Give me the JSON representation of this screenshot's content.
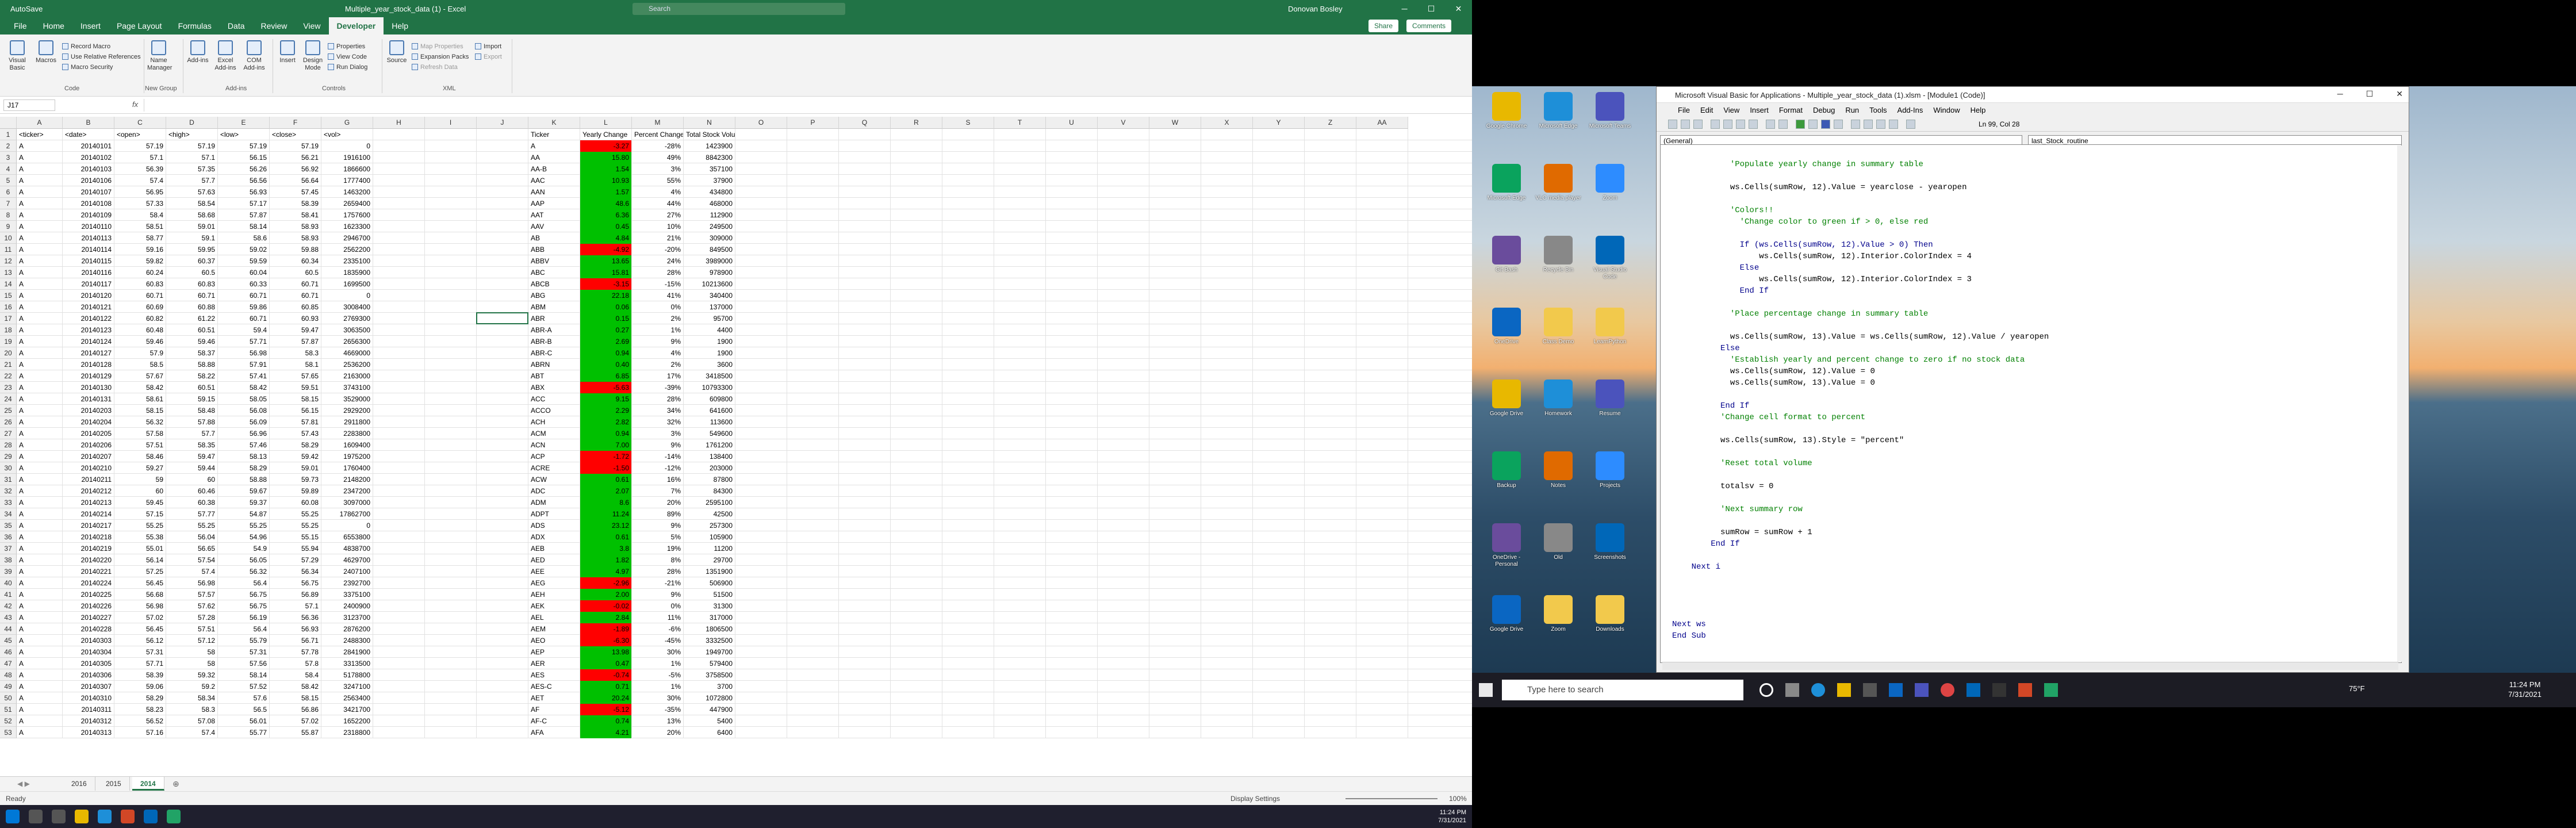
{
  "excel": {
    "title": "Multiple_year_stock_data (1) - Excel",
    "autosave": "AutoSave",
    "search_placeholder": "Search",
    "user": "Donovan Bosley",
    "menu_tabs": [
      "File",
      "Home",
      "Insert",
      "Page Layout",
      "Formulas",
      "Data",
      "Review",
      "View",
      "Developer",
      "Help"
    ],
    "active_tab": "Developer",
    "share_label": "Share",
    "comments_label": "Comments",
    "ribbon": {
      "visual_basic": "Visual Basic",
      "macros": "Macros",
      "record_macro": "Record Macro",
      "relative": "Use Relative References",
      "macro_security": "Macro Security",
      "group_code": "Code",
      "addins": "Add-ins",
      "excel_addins": "Excel Add-ins",
      "com_addins": "COM Add-ins",
      "group_addins": "Add-ins",
      "name_manager": "Name Manager",
      "group_newgroup": "New Group",
      "insert": "Insert",
      "design_mode": "Design Mode",
      "properties": "Properties",
      "view_code": "View Code",
      "run_dialog": "Run Dialog",
      "group_controls": "Controls",
      "source": "Source",
      "map_properties": "Map Properties",
      "expansion_packs": "Expansion Packs",
      "refresh_data": "Refresh Data",
      "import": "Import",
      "export": "Export",
      "group_xml": "XML"
    },
    "name_box": "J17",
    "fx": "fx",
    "col_letters": [
      "A",
      "B",
      "C",
      "D",
      "E",
      "F",
      "G",
      "H",
      "I",
      "J",
      "K",
      "L",
      "M",
      "N",
      "O",
      "P",
      "Q",
      "R",
      "S",
      "T",
      "U",
      "V",
      "W",
      "X",
      "Y",
      "Z",
      "AA"
    ],
    "headers": {
      "ticker": "<ticker>",
      "date": "<date>",
      "open": "<open>",
      "high": "<high>",
      "low": "<low>",
      "close": "<close>",
      "vol": "<vol>"
    },
    "summary_headers": {
      "ticker": "Ticker",
      "yearly": "Yearly Change",
      "percent": "Percent Change",
      "total": "Total Stock Volume"
    },
    "rows": [
      [
        "A",
        "20140101",
        "57.19",
        "57.19",
        "57.19",
        "57.19",
        "0",
        "A",
        "-3.27",
        "-28%",
        "1423900",
        "r"
      ],
      [
        "A",
        "20140102",
        "57.1",
        "57.1",
        "56.15",
        "56.21",
        "1916100",
        "AA",
        "15.80",
        "49%",
        "8842300",
        "g"
      ],
      [
        "A",
        "20140103",
        "56.39",
        "57.35",
        "56.26",
        "56.92",
        "1866600",
        "AA-B",
        "1.54",
        "3%",
        "357100",
        "g"
      ],
      [
        "A",
        "20140106",
        "57.4",
        "57.7",
        "56.56",
        "56.64",
        "1777400",
        "AAC",
        "10.93",
        "55%",
        "37900",
        "g"
      ],
      [
        "A",
        "20140107",
        "56.95",
        "57.63",
        "56.93",
        "57.45",
        "1463200",
        "AAN",
        "1.57",
        "4%",
        "434800",
        "g"
      ],
      [
        "A",
        "20140108",
        "57.33",
        "58.54",
        "57.17",
        "58.39",
        "2659400",
        "AAP",
        "48.6",
        "44%",
        "468000",
        "g"
      ],
      [
        "A",
        "20140109",
        "58.4",
        "58.68",
        "57.87",
        "58.41",
        "1757600",
        "AAT",
        "6.36",
        "27%",
        "112900",
        "g"
      ],
      [
        "A",
        "20140110",
        "58.51",
        "59.01",
        "58.14",
        "58.93",
        "1623300",
        "AAV",
        "0.45",
        "10%",
        "249500",
        "g"
      ],
      [
        "A",
        "20140113",
        "58.77",
        "59.1",
        "58.6",
        "58.93",
        "2946700",
        "AB",
        "4.84",
        "21%",
        "309000",
        "g"
      ],
      [
        "A",
        "20140114",
        "59.16",
        "59.95",
        "59.02",
        "59.88",
        "2562200",
        "ABB",
        "-4.92",
        "-20%",
        "849500",
        "r"
      ],
      [
        "A",
        "20140115",
        "59.82",
        "60.37",
        "59.59",
        "60.34",
        "2335100",
        "ABBV",
        "13.65",
        "24%",
        "3989000",
        "g"
      ],
      [
        "A",
        "20140116",
        "60.24",
        "60.5",
        "60.04",
        "60.5",
        "1835900",
        "ABC",
        "15.81",
        "28%",
        "978900",
        "g"
      ],
      [
        "A",
        "20140117",
        "60.83",
        "60.83",
        "60.33",
        "60.71",
        "1699500",
        "ABCB",
        "-3.15",
        "-15%",
        "10213600",
        "r"
      ],
      [
        "A",
        "20140120",
        "60.71",
        "60.71",
        "60.71",
        "60.71",
        "0",
        "ABG",
        "22.18",
        "41%",
        "340400",
        "g"
      ],
      [
        "A",
        "20140121",
        "60.69",
        "60.88",
        "59.86",
        "60.85",
        "3008400",
        "ABM",
        "0.06",
        "0%",
        "137000",
        "g"
      ],
      [
        "A",
        "20140122",
        "60.82",
        "61.22",
        "60.71",
        "60.93",
        "2769300",
        "ABR",
        "0.15",
        "2%",
        "95700",
        "g"
      ],
      [
        "A",
        "20140123",
        "60.48",
        "60.51",
        "59.4",
        "59.47",
        "3063500",
        "ABR-A",
        "0.27",
        "1%",
        "4400",
        "g"
      ],
      [
        "A",
        "20140124",
        "59.46",
        "59.46",
        "57.71",
        "57.87",
        "2656300",
        "ABR-B",
        "2.69",
        "9%",
        "1900",
        "g"
      ],
      [
        "A",
        "20140127",
        "57.9",
        "58.37",
        "56.98",
        "58.3",
        "4669000",
        "ABR-C",
        "0.94",
        "4%",
        "1900",
        "g"
      ],
      [
        "A",
        "20140128",
        "58.5",
        "58.88",
        "57.91",
        "58.1",
        "2536200",
        "ABRN",
        "0.40",
        "2%",
        "3600",
        "g"
      ],
      [
        "A",
        "20140129",
        "57.67",
        "58.22",
        "57.41",
        "57.65",
        "2163000",
        "ABT",
        "6.85",
        "17%",
        "3418500",
        "g"
      ],
      [
        "A",
        "20140130",
        "58.42",
        "60.51",
        "58.42",
        "59.51",
        "3743100",
        "ABX",
        "-5.63",
        "-39%",
        "10793300",
        "r"
      ],
      [
        "A",
        "20140131",
        "58.61",
        "59.15",
        "58.05",
        "58.15",
        "3529000",
        "ACC",
        "9.15",
        "28%",
        "609800",
        "g"
      ],
      [
        "A",
        "20140203",
        "58.15",
        "58.48",
        "56.08",
        "56.15",
        "2929200",
        "ACCO",
        "2.29",
        "34%",
        "641600",
        "g"
      ],
      [
        "A",
        "20140204",
        "56.32",
        "57.88",
        "56.09",
        "57.81",
        "2911800",
        "ACH",
        "2.82",
        "32%",
        "113600",
        "g"
      ],
      [
        "A",
        "20140205",
        "57.58",
        "57.7",
        "56.96",
        "57.43",
        "2283800",
        "ACM",
        "0.94",
        "3%",
        "549600",
        "g"
      ],
      [
        "A",
        "20140206",
        "57.51",
        "58.35",
        "57.46",
        "58.29",
        "1609400",
        "ACN",
        "7.00",
        "9%",
        "1761200",
        "g"
      ],
      [
        "A",
        "20140207",
        "58.46",
        "59.47",
        "58.13",
        "59.42",
        "1975200",
        "ACP",
        "-1.72",
        "-14%",
        "138400",
        "r"
      ],
      [
        "A",
        "20140210",
        "59.27",
        "59.44",
        "58.29",
        "59.01",
        "1760400",
        "ACRE",
        "-1.50",
        "-12%",
        "203000",
        "r"
      ],
      [
        "A",
        "20140211",
        "59",
        "60",
        "58.88",
        "59.73",
        "2148200",
        "ACW",
        "0.61",
        "16%",
        "87800",
        "g"
      ],
      [
        "A",
        "20140212",
        "60",
        "60.46",
        "59.67",
        "59.89",
        "2347200",
        "ADC",
        "2.07",
        "7%",
        "84300",
        "g"
      ],
      [
        "A",
        "20140213",
        "59.45",
        "60.38",
        "59.37",
        "60.08",
        "3097000",
        "ADM",
        "8.6",
        "20%",
        "2595100",
        "g"
      ],
      [
        "A",
        "20140214",
        "57.15",
        "57.77",
        "54.87",
        "55.25",
        "17862700",
        "ADPT",
        "11.24",
        "89%",
        "42500",
        "g"
      ],
      [
        "A",
        "20140217",
        "55.25",
        "55.25",
        "55.25",
        "55.25",
        "0",
        "ADS",
        "23.12",
        "9%",
        "257300",
        "g"
      ],
      [
        "A",
        "20140218",
        "55.38",
        "56.04",
        "54.96",
        "55.15",
        "6553800",
        "ADX",
        "0.61",
        "5%",
        "105900",
        "g"
      ],
      [
        "A",
        "20140219",
        "55.01",
        "56.65",
        "54.9",
        "55.94",
        "4838700",
        "AEB",
        "3.8",
        "19%",
        "11200",
        "g"
      ],
      [
        "A",
        "20140220",
        "56.14",
        "57.54",
        "56.05",
        "57.29",
        "4629700",
        "AED",
        "1.82",
        "8%",
        "29700",
        "g"
      ],
      [
        "A",
        "20140221",
        "57.25",
        "57.4",
        "56.32",
        "56.34",
        "2407100",
        "AEE",
        "4.97",
        "28%",
        "1351900",
        "g"
      ],
      [
        "A",
        "20140224",
        "56.45",
        "56.98",
        "56.4",
        "56.75",
        "2392700",
        "AEG",
        "-2.96",
        "-21%",
        "506900",
        "r"
      ],
      [
        "A",
        "20140225",
        "56.68",
        "57.57",
        "56.75",
        "56.89",
        "3375100",
        "AEH",
        "2.00",
        "9%",
        "51500",
        "g"
      ],
      [
        "A",
        "20140226",
        "56.98",
        "57.62",
        "56.75",
        "57.1",
        "2400900",
        "AEK",
        "-0.02",
        "0%",
        "31300",
        "r"
      ],
      [
        "A",
        "20140227",
        "57.02",
        "57.28",
        "56.19",
        "56.36",
        "3123700",
        "AEL",
        "2.84",
        "11%",
        "317000",
        "g"
      ],
      [
        "A",
        "20140228",
        "56.45",
        "57.51",
        "56.4",
        "56.93",
        "2876200",
        "AEM",
        "-1.89",
        "-6%",
        "1806500",
        "r"
      ],
      [
        "A",
        "20140303",
        "56.12",
        "57.12",
        "55.79",
        "56.71",
        "2488300",
        "AEO",
        "-6.30",
        "-45%",
        "3332500",
        "r"
      ],
      [
        "A",
        "20140304",
        "57.31",
        "58",
        "57.31",
        "57.78",
        "2841900",
        "AEP",
        "13.98",
        "30%",
        "1949700",
        "g"
      ],
      [
        "A",
        "20140305",
        "57.71",
        "58",
        "57.56",
        "57.8",
        "3313500",
        "AER",
        "0.47",
        "1%",
        "579400",
        "g"
      ],
      [
        "A",
        "20140306",
        "58.39",
        "59.32",
        "58.14",
        "58.4",
        "5178800",
        "AES",
        "-0.74",
        "-5%",
        "3758500",
        "r"
      ],
      [
        "A",
        "20140307",
        "59.06",
        "59.2",
        "57.52",
        "58.42",
        "3247100",
        "AES-C",
        "0.71",
        "1%",
        "3700",
        "g"
      ],
      [
        "A",
        "20140310",
        "58.29",
        "58.34",
        "57.6",
        "58.15",
        "2563400",
        "AET",
        "20.24",
        "30%",
        "1072800",
        "g"
      ],
      [
        "A",
        "20140311",
        "58.23",
        "58.3",
        "56.5",
        "56.86",
        "3421700",
        "AF",
        "-5.12",
        "-35%",
        "447900",
        "r"
      ],
      [
        "A",
        "20140312",
        "56.52",
        "57.08",
        "56.01",
        "57.02",
        "1652200",
        "AF-C",
        "0.74",
        "13%",
        "5400",
        "g"
      ],
      [
        "A",
        "20140313",
        "57.16",
        "57.4",
        "55.77",
        "55.87",
        "2318800",
        "AFA",
        "4.21",
        "20%",
        "6400",
        "g"
      ]
    ],
    "sheets": [
      "2016",
      "2015",
      "2014"
    ],
    "active_sheet": "2014",
    "status_ready": "Ready",
    "display_settings": "Display Settings",
    "zoom": "100%",
    "clock_time": "11:24 PM",
    "clock_date": "7/31/2021"
  },
  "vba": {
    "title": "Microsoft Visual Basic for Applications - Multiple_year_stock_data (1).xlsm - [Module1 (Code)]",
    "menu": [
      "File",
      "Edit",
      "View",
      "Insert",
      "Format",
      "Debug",
      "Run",
      "Tools",
      "Add-Ins",
      "Window",
      "Help"
    ],
    "position": "Ln 99, Col 28",
    "object_combo": "(General)",
    "proc_combo": "last_Stock_routine",
    "code_lines": [
      [
        "c",
        "            'Populate yearly change in summary table"
      ],
      [
        "n",
        ""
      ],
      [
        "n",
        "            ws.Cells(sumRow, 12).Value = yearclose - yearopen"
      ],
      [
        "n",
        ""
      ],
      [
        "c",
        "            'Colors!!"
      ],
      [
        "c",
        "              'Change color to green if > 0, else red"
      ],
      [
        "n",
        ""
      ],
      [
        "k",
        "              If (ws.Cells(sumRow, 12).Value > 0) Then"
      ],
      [
        "n",
        "                  ws.Cells(sumRow, 12).Interior.ColorIndex = 4"
      ],
      [
        "k",
        "              Else"
      ],
      [
        "n",
        "                  ws.Cells(sumRow, 12).Interior.ColorIndex = 3"
      ],
      [
        "k",
        "              End If"
      ],
      [
        "n",
        ""
      ],
      [
        "c",
        "            'Place percentage change in summary table"
      ],
      [
        "n",
        ""
      ],
      [
        "n",
        "            ws.Cells(sumRow, 13).Value = ws.Cells(sumRow, 12).Value / yearopen"
      ],
      [
        "k",
        "          Else"
      ],
      [
        "c",
        "            'Establish yearly and percent change to zero if no stock data"
      ],
      [
        "n",
        "            ws.Cells(sumRow, 12).Value = 0"
      ],
      [
        "n",
        "            ws.Cells(sumRow, 13).Value = 0"
      ],
      [
        "n",
        ""
      ],
      [
        "k",
        "          End If"
      ],
      [
        "c",
        "          'Change cell format to percent"
      ],
      [
        "n",
        ""
      ],
      [
        "n",
        "          ws.Cells(sumRow, 13).Style = \"percent\""
      ],
      [
        "n",
        ""
      ],
      [
        "c",
        "          'Reset total volume"
      ],
      [
        "n",
        ""
      ],
      [
        "n",
        "          totalsv = 0"
      ],
      [
        "n",
        ""
      ],
      [
        "c",
        "          'Next summary row"
      ],
      [
        "n",
        ""
      ],
      [
        "n",
        "          sumRow = sumRow + 1"
      ],
      [
        "k",
        "        End If"
      ],
      [
        "n",
        ""
      ],
      [
        "k",
        "    Next i"
      ],
      [
        "n",
        ""
      ],
      [
        "n",
        ""
      ],
      [
        "n",
        ""
      ],
      [
        "n",
        ""
      ],
      [
        "k",
        "Next ws"
      ],
      [
        "k",
        "End Sub"
      ]
    ]
  },
  "desktop": {
    "icons": [
      {
        "label": "Google Chrome"
      },
      {
        "label": "Microsoft Edge"
      },
      {
        "label": "Microsoft Teams"
      },
      {
        "label": "Microsoft Edge"
      },
      {
        "label": "VLC media player"
      },
      {
        "label": "Zoom"
      },
      {
        "label": "Git Bash"
      },
      {
        "label": "Recycle Bin"
      },
      {
        "label": "Visual Studio Code"
      },
      {
        "label": "OneDrive"
      },
      {
        "label": "Class Demo"
      },
      {
        "label": "LearnPython"
      },
      {
        "label": "Google Drive"
      },
      {
        "label": "Homework"
      },
      {
        "label": "Resume"
      },
      {
        "label": "Backup"
      },
      {
        "label": "Notes"
      },
      {
        "label": "Projects"
      },
      {
        "label": "OneDrive - Personal"
      },
      {
        "label": "Old"
      },
      {
        "label": "Screenshots"
      },
      {
        "label": "Google Drive"
      },
      {
        "label": "Zoom"
      },
      {
        "label": "Downloads"
      }
    ],
    "search_placeholder": "Type here to search",
    "temperature": "75°F",
    "clock_time": "11:24 PM",
    "clock_date": "7/31/2021"
  },
  "colors": {
    "excel_green": "#217346",
    "positive": "#00c000",
    "negative": "#ff0000"
  }
}
